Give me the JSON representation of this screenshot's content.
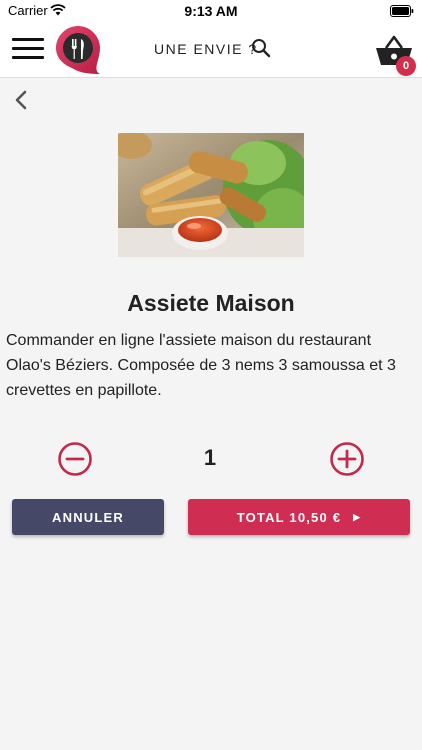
{
  "status_bar": {
    "carrier": "Carrier",
    "time": "9:13 AM"
  },
  "header": {
    "search_label": "UNE ENVIE ?",
    "cart_count": "0",
    "logo_icon": "fork-knife-pin-icon",
    "colors": {
      "brand": "#d32f4d"
    }
  },
  "product": {
    "name": "Assiete Maison",
    "description": "Commander en ligne l'assiete maison du restaurant Olao's Béziers. Composée de 3 nems 3 samoussa et 3 crevettes en papillote.",
    "quantity": "1"
  },
  "actions": {
    "cancel_label": "ANNULER",
    "total_label": "TOTAL 10,50 €",
    "colors": {
      "cancel": "#464868",
      "total": "#cf2d52"
    }
  }
}
